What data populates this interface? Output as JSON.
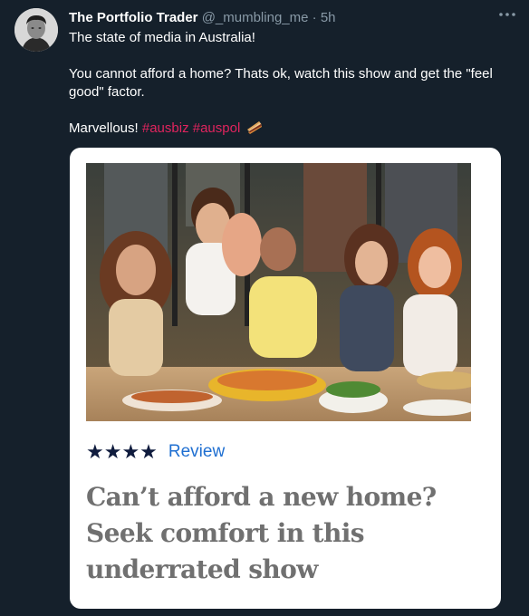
{
  "tweet": {
    "author_name": "The Portfolio Trader",
    "handle": "@_mumbling_me",
    "separator": "·",
    "time": "5h",
    "more_icon": "more-horizontal-icon",
    "line1": "The state of media in Australia!",
    "line2": "You cannot afford a home? Thats ok, watch this show and get the \"feel good\" factor.",
    "line3_text": "Marvellous!",
    "hashtags": [
      "#ausbiz",
      "#auspol"
    ],
    "emoji_icon": "sandwich-emoji-icon"
  },
  "card": {
    "stars": "★★★★",
    "rating_value": 4,
    "review_label": "Review",
    "headline": "Can’t afford a new home? Seek comfort in this underrated show"
  },
  "colors": {
    "background": "#15202b",
    "hashtag": "#e0245e",
    "review_link": "#1f6fd1",
    "stars": "#0f1b3d",
    "headline": "#707070"
  }
}
